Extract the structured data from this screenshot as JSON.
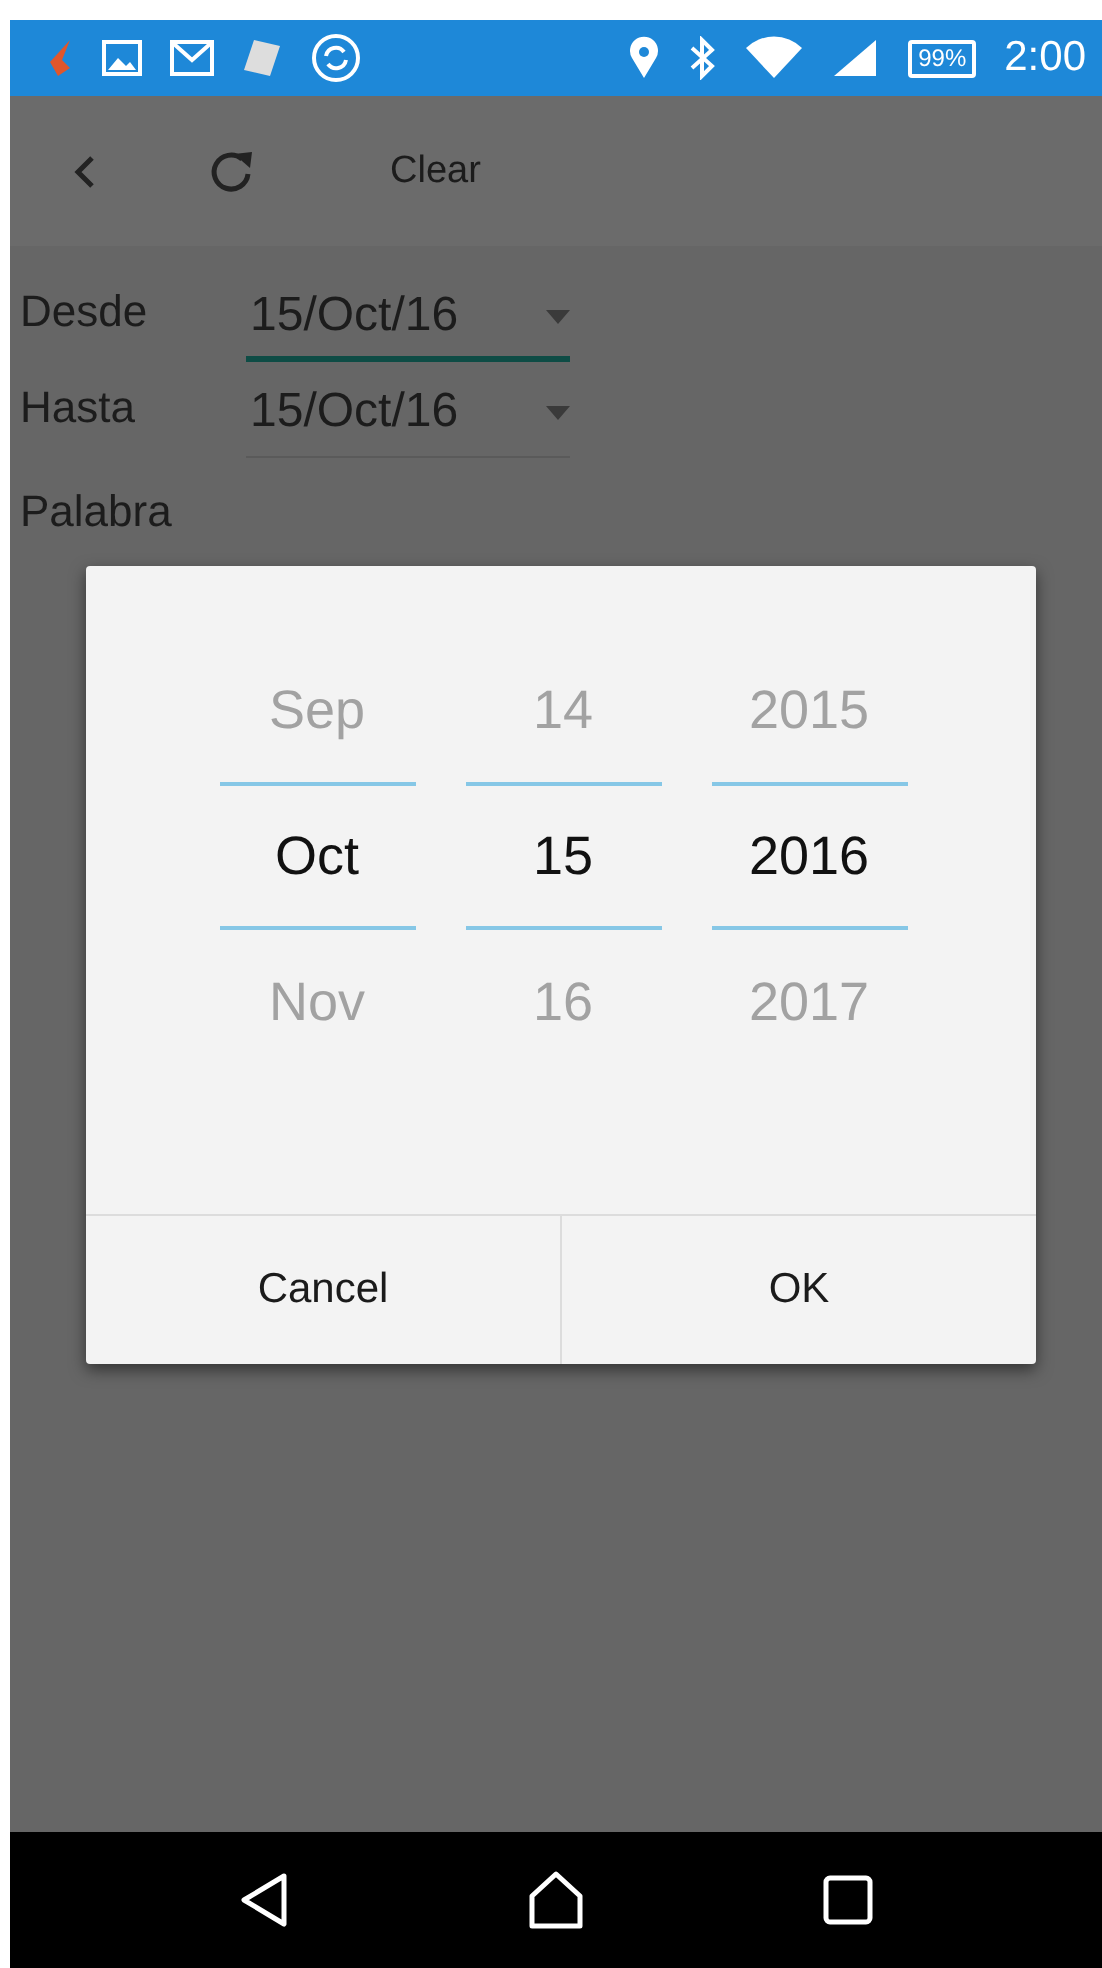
{
  "status_bar": {
    "battery": "99%",
    "time": "2:00"
  },
  "toolbar": {
    "clear": "Clear"
  },
  "fields": [
    {
      "label": "Desde",
      "value": "15/Oct/16",
      "focused": true
    },
    {
      "label": "Hasta",
      "value": "15/Oct/16",
      "focused": false
    }
  ],
  "keyword": {
    "label": "Palabra"
  },
  "date_picker": {
    "columns": [
      {
        "previous": "Sep",
        "current": "Oct",
        "next": "Nov"
      },
      {
        "previous": "14",
        "current": "15",
        "next": "16"
      },
      {
        "previous": "2015",
        "current": "2016",
        "next": "2017"
      }
    ],
    "buttons": [
      "Cancel",
      "OK"
    ]
  }
}
